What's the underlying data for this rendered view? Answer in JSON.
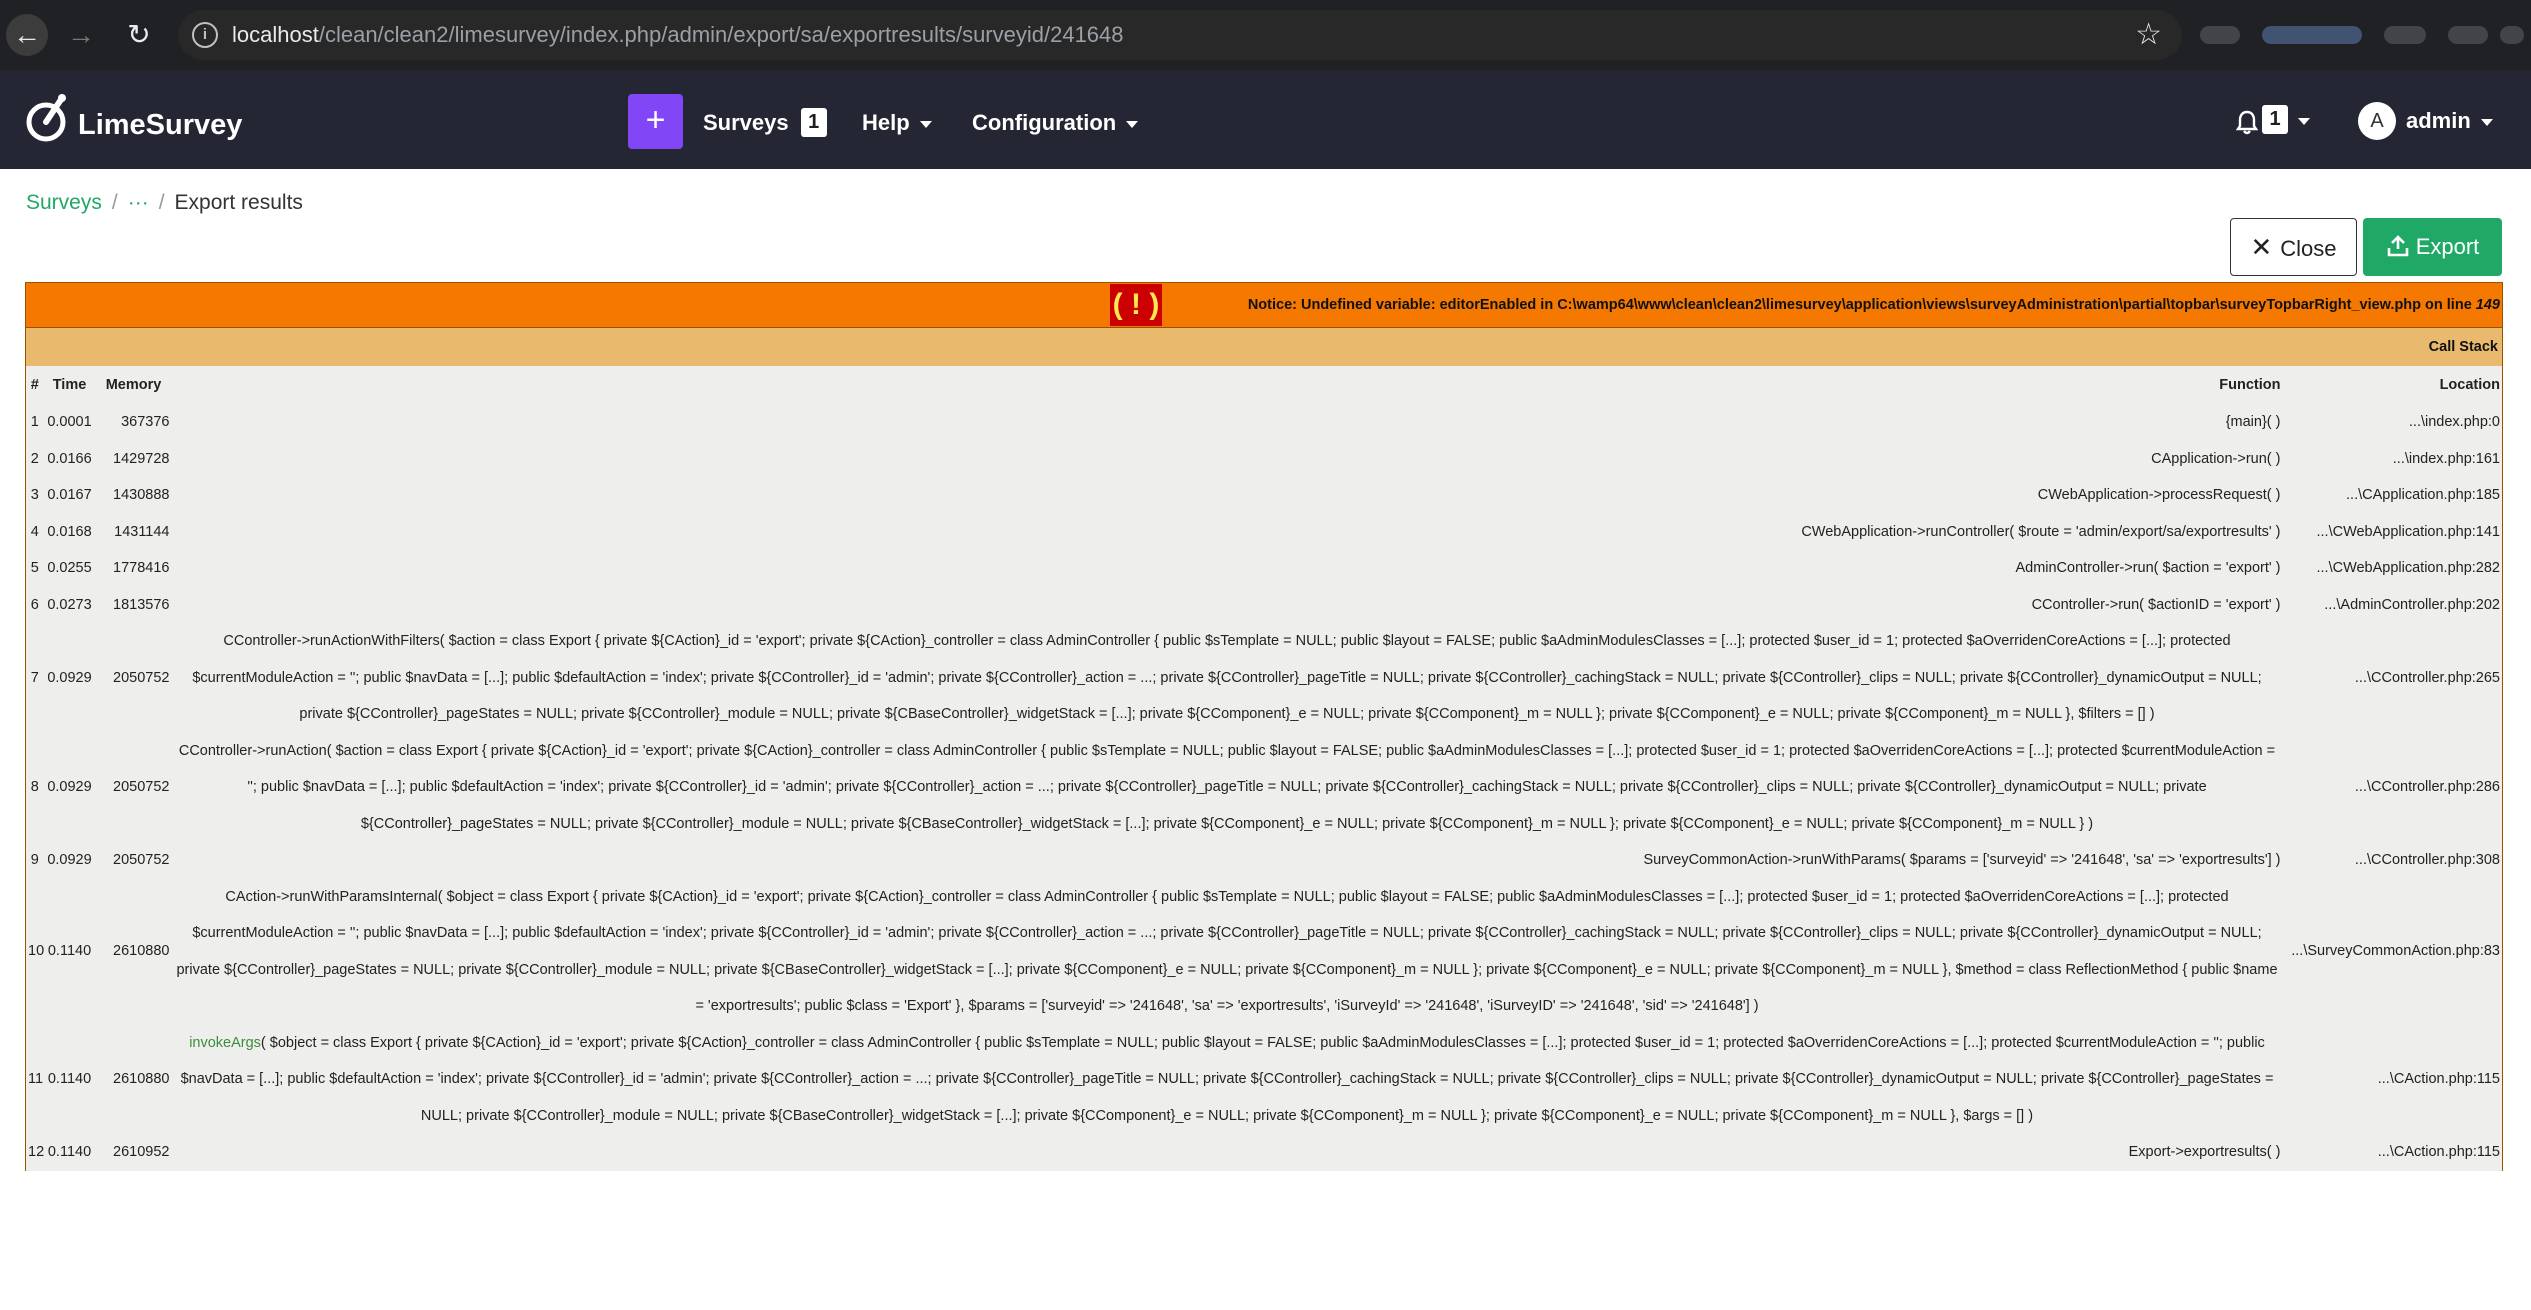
{
  "browser": {
    "url_host": "localhost",
    "url_path": "/clean/clean2/limesurvey/index.php/admin/export/sa/exportresults/surveyid/241648"
  },
  "header": {
    "logo_text": "LimeSurvey",
    "plus_label": "+",
    "surveys_label": "Surveys",
    "surveys_count": "1",
    "help_label": "Help",
    "config_label": "Configuration",
    "notifications_count": "1",
    "avatar_letter": "A",
    "user_name": "admin"
  },
  "breadcrumb": {
    "root": "Surveys",
    "ellipsis": "···",
    "current": "Export results"
  },
  "actions": {
    "close_label": "Close",
    "export_label": "Export"
  },
  "error": {
    "icon": "( ! )",
    "message": "Notice: Undefined variable: editorEnabled in C:\\wamp64\\www\\clean\\clean2\\limesurvey\\application\\views\\surveyAdministration\\partial\\topbar\\surveyTopbarRight_view.php on line ",
    "line": "149",
    "stack_title": "Call Stack",
    "columns": [
      "#",
      "Time",
      "Memory",
      "Function",
      "Location"
    ],
    "rows": [
      {
        "num": "1",
        "time": "0.0001",
        "memory": "367376",
        "function": "{main}( )",
        "location": "...\\index.php:0"
      },
      {
        "num": "2",
        "time": "0.0166",
        "memory": "1429728",
        "function": "CApplication->run( )",
        "location": "...\\index.php:161"
      },
      {
        "num": "3",
        "time": "0.0167",
        "memory": "1430888",
        "function": "CWebApplication->processRequest( )",
        "location": "...\\CApplication.php:185"
      },
      {
        "num": "4",
        "time": "0.0168",
        "memory": "1431144",
        "function": "CWebApplication->runController( $route = 'admin/export/sa/exportresults' )",
        "location": "...\\CWebApplication.php:141"
      },
      {
        "num": "5",
        "time": "0.0255",
        "memory": "1778416",
        "function": "AdminController->run( $action = 'export' )",
        "location": "...\\CWebApplication.php:282"
      },
      {
        "num": "6",
        "time": "0.0273",
        "memory": "1813576",
        "function": "CController->run( $actionID = 'export' )",
        "location": "...\\AdminController.php:202"
      },
      {
        "num": "7",
        "time": "0.0929",
        "memory": "2050752",
        "function": "CController->runActionWithFilters( $action = class Export { private ${CAction}_id = 'export'; private ${CAction}_controller = class AdminController { public $sTemplate = NULL; public $layout = FALSE; public $aAdminModulesClasses = [...]; protected $user_id = 1; protected $aOverridenCoreActions = [...]; protected $currentModuleAction = ''; public $navData = [...]; public $defaultAction = 'index'; private ${CController}_id = 'admin'; private ${CController}_action = ...; private ${CController}_pageTitle = NULL; private ${CController}_cachingStack = NULL; private ${CController}_clips = NULL; private ${CController}_dynamicOutput = NULL; private ${CController}_pageStates = NULL; private ${CController}_module = NULL; private ${CBaseController}_widgetStack = [...]; private ${CComponent}_e = NULL; private ${CComponent}_m = NULL }; private ${CComponent}_e = NULL; private ${CComponent}_m = NULL }, $filters = [] )",
        "location": "...\\CController.php:265"
      },
      {
        "num": "8",
        "time": "0.0929",
        "memory": "2050752",
        "function": "CController->runAction( $action = class Export { private ${CAction}_id = 'export'; private ${CAction}_controller = class AdminController { public $sTemplate = NULL; public $layout = FALSE; public $aAdminModulesClasses = [...]; protected $user_id = 1; protected $aOverridenCoreActions = [...]; protected $currentModuleAction = ''; public $navData = [...]; public $defaultAction = 'index'; private ${CController}_id = 'admin'; private ${CController}_action = ...; private ${CController}_pageTitle = NULL; private ${CController}_cachingStack = NULL; private ${CController}_clips = NULL; private ${CController}_dynamicOutput = NULL; private ${CController}_pageStates = NULL; private ${CController}_module = NULL; private ${CBaseController}_widgetStack = [...]; private ${CComponent}_e = NULL; private ${CComponent}_m = NULL }; private ${CComponent}_e = NULL; private ${CComponent}_m = NULL } )",
        "location": "...\\CController.php:286"
      },
      {
        "num": "9",
        "time": "0.0929",
        "memory": "2050752",
        "function": "SurveyCommonAction->runWithParams( $params = ['surveyid' => '241648', 'sa' => 'exportresults'] )",
        "location": "...\\CController.php:308"
      },
      {
        "num": "10",
        "time": "0.1140",
        "memory": "2610880",
        "function": "CAction->runWithParamsInternal( $object = class Export { private ${CAction}_id = 'export'; private ${CAction}_controller = class AdminController { public $sTemplate = NULL; public $layout = FALSE; public $aAdminModulesClasses = [...]; protected $user_id = 1; protected $aOverridenCoreActions = [...]; protected $currentModuleAction = ''; public $navData = [...]; public $defaultAction = 'index'; private ${CController}_id = 'admin'; private ${CController}_action = ...; private ${CController}_pageTitle = NULL; private ${CController}_cachingStack = NULL; private ${CController}_clips = NULL; private ${CController}_dynamicOutput = NULL; private ${CController}_pageStates = NULL; private ${CController}_module = NULL; private ${CBaseController}_widgetStack = [...]; private ${CComponent}_e = NULL; private ${CComponent}_m = NULL }; private ${CComponent}_e = NULL; private ${CComponent}_m = NULL }, $method = class ReflectionMethod { public $name = 'exportresults'; public $class = 'Export' }, $params = ['surveyid' => '241648', 'sa' => 'exportresults', 'iSurveyId' => '241648', 'iSurveyID' => '241648', 'sid' => '241648'] )",
        "location": "...\\SurveyCommonAction.php:83"
      },
      {
        "num": "11",
        "time": "0.1140",
        "memory": "2610880",
        "fn_link": "invokeArgs",
        "function": "( $object = class Export { private ${CAction}_id = 'export'; private ${CAction}_controller = class AdminController { public $sTemplate = NULL; public $layout = FALSE; public $aAdminModulesClasses = [...]; protected $user_id = 1; protected $aOverridenCoreActions = [...]; protected $currentModuleAction = ''; public $navData = [...]; public $defaultAction = 'index'; private ${CController}_id = 'admin'; private ${CController}_action = ...; private ${CController}_pageTitle = NULL; private ${CController}_cachingStack = NULL; private ${CController}_clips = NULL; private ${CController}_dynamicOutput = NULL; private ${CController}_pageStates = NULL; private ${CController}_module = NULL; private ${CBaseController}_widgetStack = [...]; private ${CComponent}_e = NULL; private ${CComponent}_m = NULL }; private ${CComponent}_e = NULL; private ${CComponent}_m = NULL }, $args = [] )",
        "location": "...\\CAction.php:115"
      },
      {
        "num": "12",
        "time": "0.1140",
        "memory": "2610952",
        "function": "Export->exportresults( )",
        "location": "...\\CAction.php:115"
      }
    ]
  }
}
